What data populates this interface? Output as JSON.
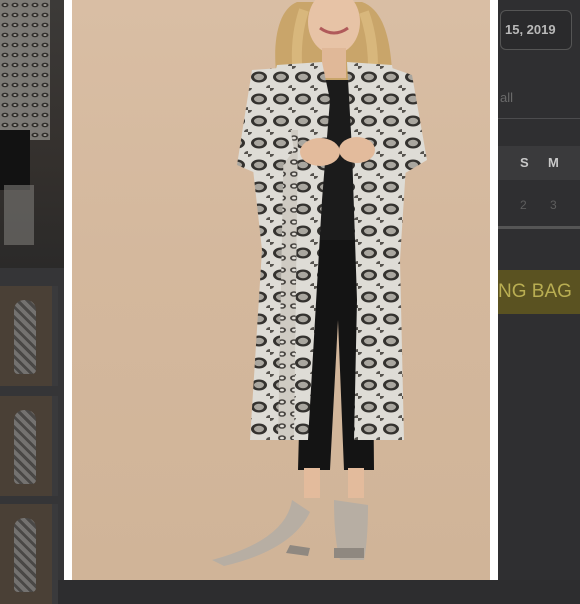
{
  "gallery": {
    "main_image_alt": "Model wearing long snakeskin print duster cardigan with black top, black jeans and nude heeled sandals",
    "thumbnail_count": 3
  },
  "right_panel": {
    "date_text": "15, 2019",
    "all_link": "all",
    "calendar_days": [
      "S",
      "M"
    ],
    "calendar_dates": [
      "2",
      "3"
    ],
    "button_label": "NG BAG"
  },
  "colors": {
    "backdrop": "#d4b89d",
    "page_overlay": "#2d2d2f",
    "button": "#5a5221"
  }
}
